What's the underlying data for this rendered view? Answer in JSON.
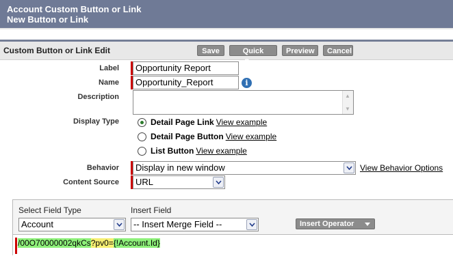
{
  "header": {
    "line1": "Account Custom Button or Link",
    "line2": "New Button or Link"
  },
  "edit_bar": {
    "title": "Custom Button or Link Edit",
    "buttons": {
      "save": "Save",
      "quick_save": "Quick Save",
      "preview": "Preview",
      "cancel": "Cancel"
    }
  },
  "form": {
    "label": {
      "caption": "Label",
      "value": "Opportunity Report"
    },
    "name": {
      "caption": "Name",
      "value": "Opportunity_Report"
    },
    "description": {
      "caption": "Description",
      "value": ""
    },
    "display_type": {
      "caption": "Display Type",
      "options": [
        {
          "label": "Detail Page Link",
          "link": "View example",
          "selected": true
        },
        {
          "label": "Detail Page Button",
          "link": "View example",
          "selected": false
        },
        {
          "label": "List Button",
          "link": "View example",
          "selected": false
        }
      ]
    },
    "behavior": {
      "caption": "Behavior",
      "value": "Display in new window",
      "link": "View Behavior Options"
    },
    "content_source": {
      "caption": "Content Source",
      "value": "URL"
    }
  },
  "formula_editor": {
    "select_field_type_label": "Select Field Type",
    "select_field_type_value": "Account",
    "insert_field_label": "Insert Field",
    "insert_field_value": "-- Insert Merge Field --",
    "insert_operator": "Insert Operator",
    "formula_parts": {
      "url": "/00O70000002qkCs",
      "param": "?pv0=",
      "merge_field": "{!Account.Id}"
    }
  },
  "colors": {
    "header_bg": "#6f7a96",
    "required_marker": "#cc0000",
    "button_bg": "#8c8c8c",
    "highlight_green": "#8ef07a",
    "highlight_yellow": "#f6ef72"
  }
}
